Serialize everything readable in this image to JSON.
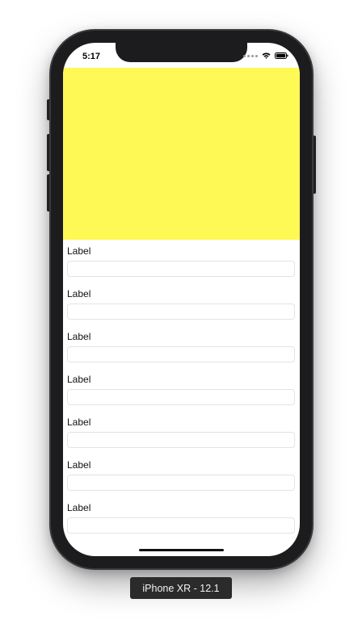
{
  "status_bar": {
    "time": "5:17"
  },
  "colors": {
    "yellow_view": "#fff955",
    "phone_frame": "#1c1c1e"
  },
  "form": {
    "fields": [
      {
        "label": "Label",
        "value": ""
      },
      {
        "label": "Label",
        "value": ""
      },
      {
        "label": "Label",
        "value": ""
      },
      {
        "label": "Label",
        "value": ""
      },
      {
        "label": "Label",
        "value": ""
      },
      {
        "label": "Label",
        "value": ""
      },
      {
        "label": "Label",
        "value": ""
      }
    ]
  },
  "device": {
    "caption": "iPhone XR - 12.1"
  },
  "icons": {
    "signal": "cellular-signal-icon",
    "wifi": "wifi-icon",
    "battery": "battery-icon"
  }
}
